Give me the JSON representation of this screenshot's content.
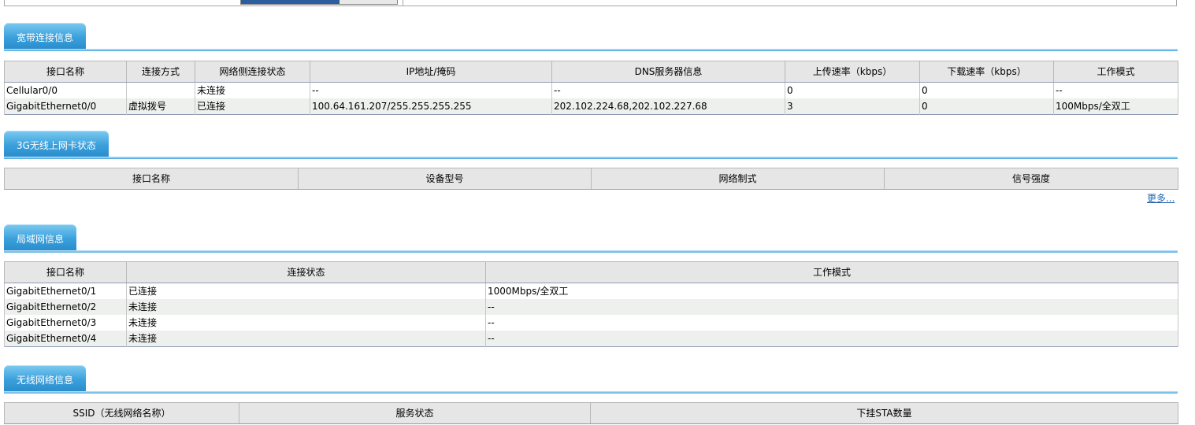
{
  "top_progress": {
    "fill": 0.63
  },
  "broadband": {
    "title": "宽带连接信息",
    "columns": [
      "接口名称",
      "连接方式",
      "网络侧连接状态",
      "IP地址/掩码",
      "DNS服务器信息",
      "上传速率（kbps）",
      "下载速率（kbps）",
      "工作模式"
    ],
    "rows": [
      [
        "Cellular0/0",
        "",
        "未连接",
        "--",
        "--",
        "0",
        "0",
        "--"
      ],
      [
        "GigabitEthernet0/0",
        "虚拟拨号",
        "已连接",
        "100.64.161.207/255.255.255.255",
        "202.102.224.68,202.102.227.68",
        "3",
        "0",
        "100Mbps/全双工"
      ]
    ]
  },
  "wireless3g": {
    "title": "3G无线上网卡状态",
    "columns": [
      "接口名称",
      "设备型号",
      "网络制式",
      "信号强度"
    ],
    "more_label": "更多..."
  },
  "lan": {
    "title": "局域网信息",
    "columns": [
      "接口名称",
      "连接状态",
      "工作模式"
    ],
    "rows": [
      [
        "GigabitEthernet0/1",
        "已连接",
        "1000Mbps/全双工"
      ],
      [
        "GigabitEthernet0/2",
        "未连接",
        "--"
      ],
      [
        "GigabitEthernet0/3",
        "未连接",
        "--"
      ],
      [
        "GigabitEthernet0/4",
        "未连接",
        "--"
      ]
    ]
  },
  "wlan": {
    "title": "无线网络信息",
    "columns": [
      "SSID（无线网络名称）",
      "服务状态",
      "下挂STA数量"
    ]
  }
}
